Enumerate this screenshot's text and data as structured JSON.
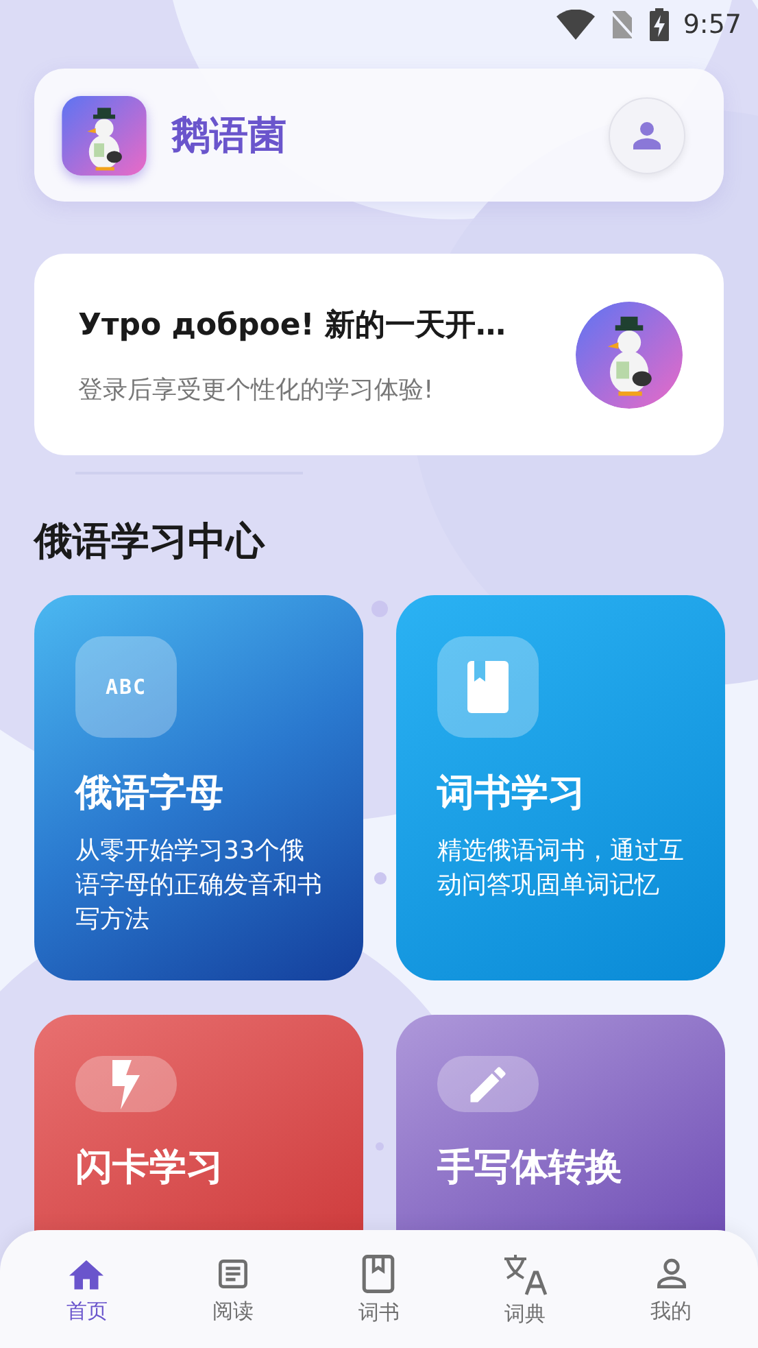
{
  "status_bar": {
    "time": "9:57"
  },
  "header": {
    "app_name": "鹅语菌"
  },
  "greeting": {
    "title": "Утро доброе! 新的一天开…",
    "subtitle": "登录后享受更个性化的学习体验!"
  },
  "section_title": "俄语学习中心",
  "cards": [
    {
      "kind": "alphabet",
      "icon_text": "ABC",
      "title": "俄语字母",
      "description": "从零开始学习33个俄语字母的正确发音和书写方法"
    },
    {
      "kind": "book",
      "title": "词书学习",
      "description": "精选俄语词书，通过互动问答巩固单词记忆"
    },
    {
      "kind": "flash",
      "title": "闪卡学习"
    },
    {
      "kind": "pen",
      "title": "手写体转换"
    }
  ],
  "nav": [
    {
      "label": "首页",
      "selected": true
    },
    {
      "label": "阅读",
      "selected": false
    },
    {
      "label": "词书",
      "selected": false
    },
    {
      "label": "词典",
      "selected": false
    },
    {
      "label": "我的",
      "selected": false
    }
  ]
}
